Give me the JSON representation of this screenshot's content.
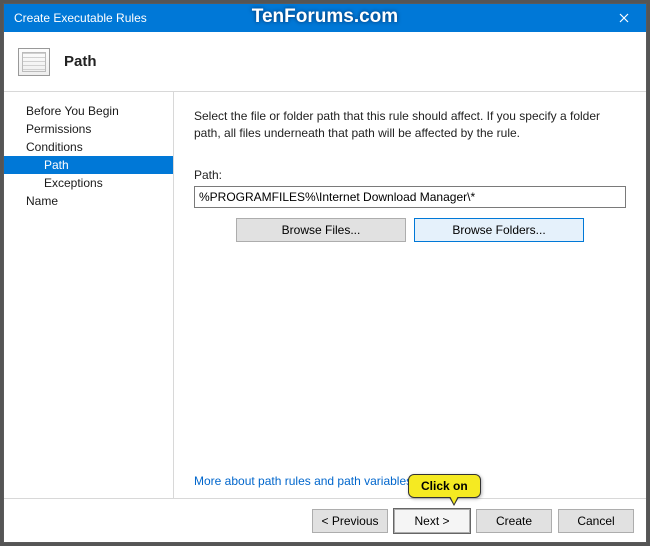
{
  "titlebar": {
    "title": "Create Executable Rules"
  },
  "header": {
    "title": "Path"
  },
  "sidebar": {
    "items": [
      {
        "label": "Before You Begin"
      },
      {
        "label": "Permissions"
      },
      {
        "label": "Conditions"
      },
      {
        "label": "Path"
      },
      {
        "label": "Exceptions"
      },
      {
        "label": "Name"
      }
    ]
  },
  "content": {
    "instruction": "Select the file or folder path that this rule should affect. If you specify a folder path, all files underneath that path will be affected by the rule.",
    "path_label": "Path:",
    "path_value": "%PROGRAMFILES%\\Internet Download Manager\\*",
    "browse_files": "Browse Files...",
    "browse_folders": "Browse Folders...",
    "more_link": "More about path rules and path variables"
  },
  "footer": {
    "previous": "< Previous",
    "next": "Next >",
    "create": "Create",
    "cancel": "Cancel"
  },
  "annotation": {
    "callout": "Click on",
    "watermark": "TenForums.com"
  }
}
